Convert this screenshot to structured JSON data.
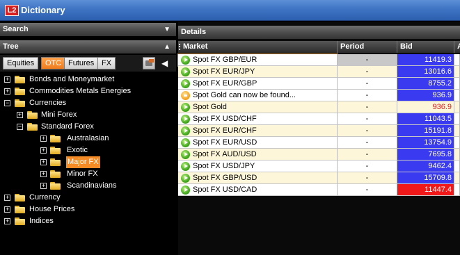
{
  "window": {
    "logo": "L2",
    "title": "Dictionary"
  },
  "search_panel": {
    "label": "Search"
  },
  "tree_panel": {
    "label": "Tree"
  },
  "tabs": [
    {
      "label": "Equities",
      "active": false
    },
    {
      "label": "OTC",
      "active": true
    },
    {
      "label": "Futures",
      "active": false
    },
    {
      "label": "FX",
      "active": false
    }
  ],
  "tree": {
    "expand_symbol": "+",
    "collapse_symbol": "−",
    "nodes": [
      {
        "label": "Bonds and Moneymarket",
        "expanded": false
      },
      {
        "label": "Commodities Metals Energies",
        "expanded": false
      },
      {
        "label": "Currencies",
        "expanded": true
      },
      {
        "label": "Mini Forex",
        "expanded": false
      },
      {
        "label": "Standard Forex",
        "expanded": true
      },
      {
        "label": "Australasian",
        "expanded": false
      },
      {
        "label": "Exotic",
        "expanded": false
      },
      {
        "label": "Major FX",
        "expanded": false,
        "selected": true
      },
      {
        "label": "Minor FX",
        "expanded": false
      },
      {
        "label": "Scandinavians",
        "expanded": false
      },
      {
        "label": "Currency",
        "expanded": false
      },
      {
        "label": "House Prices",
        "expanded": false
      },
      {
        "label": "Indices",
        "expanded": false
      }
    ]
  },
  "details": {
    "label": "Details",
    "columns": {
      "market": "Market",
      "period": "Period",
      "bid": "Bid",
      "ask": "A"
    },
    "rows": [
      {
        "market": "Spot FX GBP/EUR",
        "period": "-",
        "bid": "11419.3",
        "bid_bg": "#3a3af0",
        "status": "live",
        "bg": "#ffffff",
        "period_bg": "#c8c8c8",
        "selected": true
      },
      {
        "market": "Spot FX EUR/JPY",
        "period": "-",
        "bid": "13016.6",
        "bid_bg": "#3a3af0",
        "status": "live",
        "bg": "#fdf6d8"
      },
      {
        "market": "Spot FX EUR/GBP",
        "period": "-",
        "bid": "8755.2",
        "bid_bg": "#3a3af0",
        "status": "live",
        "bg": "#ffffff"
      },
      {
        "market": "Spot Gold can now be found...",
        "period": "-",
        "bid": "936.9",
        "bid_bg": "#3a3af0",
        "status": "warn",
        "bg": "#ffffff"
      },
      {
        "market": "Spot Gold",
        "period": "-",
        "bid": "936.9",
        "bid_bg": "#fdf6d8",
        "bid_color": "#e02020",
        "status": "live",
        "bg": "#fdf6d8"
      },
      {
        "market": "Spot FX USD/CHF",
        "period": "-",
        "bid": "11043.5",
        "bid_bg": "#3a3af0",
        "status": "live",
        "bg": "#ffffff"
      },
      {
        "market": "Spot FX EUR/CHF",
        "period": "-",
        "bid": "15191.8",
        "bid_bg": "#3a3af0",
        "status": "live",
        "bg": "#fdf6d8"
      },
      {
        "market": "Spot FX EUR/USD",
        "period": "-",
        "bid": "13754.9",
        "bid_bg": "#3a3af0",
        "status": "live",
        "bg": "#ffffff"
      },
      {
        "market": "Spot FX AUD/USD",
        "period": "-",
        "bid": "7695.8",
        "bid_bg": "#3a3af0",
        "status": "live",
        "bg": "#fdf6d8"
      },
      {
        "market": "Spot FX USD/JPY",
        "period": "-",
        "bid": "9462.4",
        "bid_bg": "#3a3af0",
        "status": "live",
        "bg": "#ffffff"
      },
      {
        "market": "Spot FX GBP/USD",
        "period": "-",
        "bid": "15709.8",
        "bid_bg": "#3a3af0",
        "status": "live",
        "bg": "#fdf6d8"
      },
      {
        "market": "Spot FX USD/CAD",
        "period": "-",
        "bid": "11447.4",
        "bid_bg": "#f01818",
        "status": "live",
        "bg": "#ffffff"
      }
    ]
  },
  "icons": {
    "collapse": "triangle-down-icon",
    "expand": "triangle-up-icon",
    "tree_option": "tree-options-icon",
    "panel_collapse": "triangle-left-icon",
    "status_live": "green-play-icon",
    "status_warn": "amber-info-icon",
    "folder": "folder-icon"
  }
}
